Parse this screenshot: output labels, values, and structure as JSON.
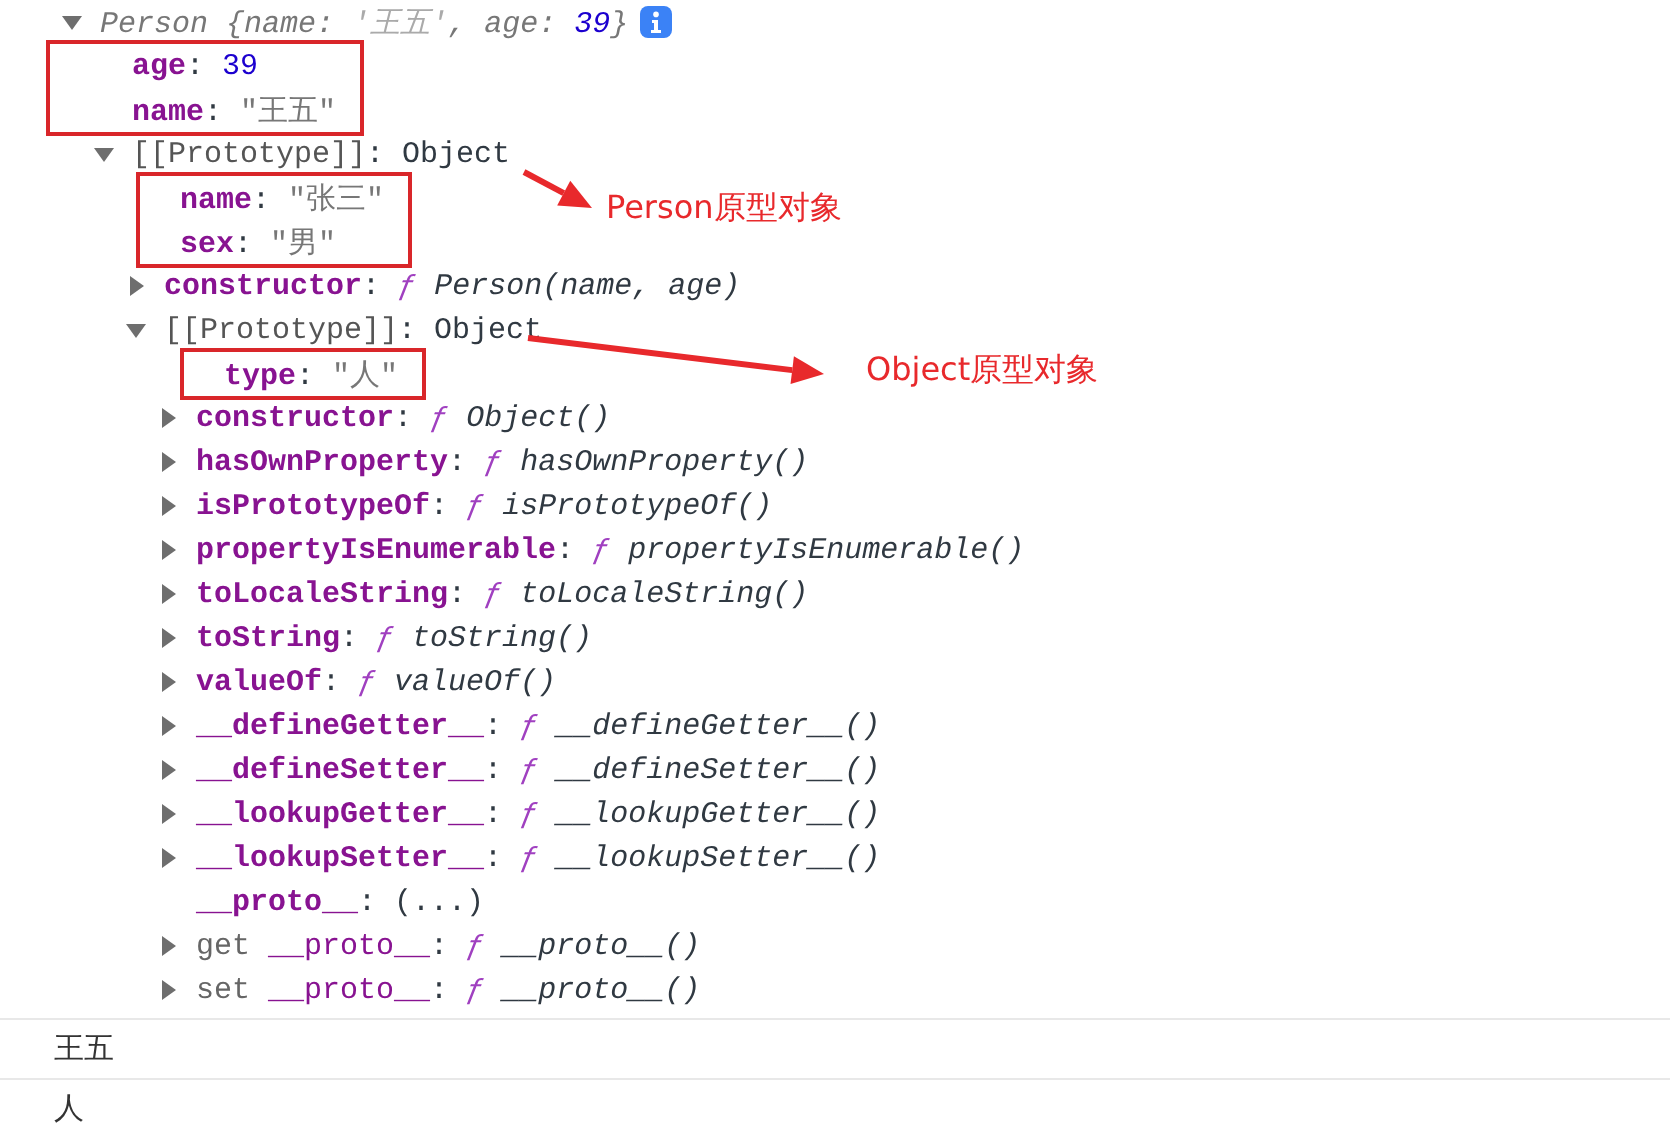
{
  "tree": [
    {
      "expanded": true,
      "info_badge": true,
      "parts": [
        {
          "text": "Person ",
          "kind": "summary"
        },
        {
          "text": "{",
          "kind": "summary"
        },
        {
          "text": "name",
          "kind": "skey"
        },
        {
          "text": ": ",
          "kind": "summary"
        },
        {
          "text": "'王五'",
          "kind": "sstring"
        },
        {
          "text": ", ",
          "kind": "summary"
        },
        {
          "text": "age",
          "kind": "skey"
        },
        {
          "text": ": ",
          "kind": "summary"
        },
        {
          "text": "39",
          "kind": "snumber"
        },
        {
          "text": "}",
          "kind": "summary"
        }
      ],
      "children": [
        {
          "boxed": true,
          "parts": [
            {
              "text": "age",
              "kind": "key"
            },
            {
              "text": ": ",
              "kind": "punct"
            },
            {
              "text": "39",
              "kind": "number"
            }
          ]
        },
        {
          "boxed": true,
          "parts": [
            {
              "text": "name",
              "kind": "key"
            },
            {
              "text": ": ",
              "kind": "punct"
            },
            {
              "text": "\"王五\"",
              "kind": "string"
            }
          ]
        },
        {
          "expanded": true,
          "parts": [
            {
              "text": "[[Prototype]]",
              "kind": "internal"
            },
            {
              "text": ": ",
              "kind": "punct"
            },
            {
              "text": "Object",
              "kind": "object"
            }
          ],
          "children": [
            {
              "boxed": true,
              "parts": [
                {
                  "text": "name",
                  "kind": "key"
                },
                {
                  "text": ": ",
                  "kind": "punct"
                },
                {
                  "text": "\"张三\"",
                  "kind": "string"
                }
              ]
            },
            {
              "boxed": true,
              "parts": [
                {
                  "text": "sex",
                  "kind": "key"
                },
                {
                  "text": ": ",
                  "kind": "punct"
                },
                {
                  "text": "\"男\"",
                  "kind": "string"
                }
              ]
            },
            {
              "expanded": false,
              "parts": [
                {
                  "text": "constructor",
                  "kind": "key"
                },
                {
                  "text": ": ",
                  "kind": "punct"
                },
                {
                  "text": "ƒ ",
                  "kind": "fsign"
                },
                {
                  "text": "Person(name, age)",
                  "kind": "fname"
                }
              ]
            },
            {
              "expanded": true,
              "parts": [
                {
                  "text": "[[Prototype]]",
                  "kind": "internal"
                },
                {
                  "text": ": ",
                  "kind": "punct"
                },
                {
                  "text": "Object",
                  "kind": "object"
                }
              ],
              "children": [
                {
                  "boxed": true,
                  "parts": [
                    {
                      "text": "type",
                      "kind": "key"
                    },
                    {
                      "text": ": ",
                      "kind": "punct"
                    },
                    {
                      "text": "\"人\"",
                      "kind": "string"
                    }
                  ]
                },
                {
                  "expanded": false,
                  "parts": [
                    {
                      "text": "constructor",
                      "kind": "key"
                    },
                    {
                      "text": ": ",
                      "kind": "punct"
                    },
                    {
                      "text": "ƒ ",
                      "kind": "fsign"
                    },
                    {
                      "text": "Object()",
                      "kind": "fname"
                    }
                  ]
                },
                {
                  "expanded": false,
                  "parts": [
                    {
                      "text": "hasOwnProperty",
                      "kind": "key"
                    },
                    {
                      "text": ": ",
                      "kind": "punct"
                    },
                    {
                      "text": "ƒ ",
                      "kind": "fsign"
                    },
                    {
                      "text": "hasOwnProperty()",
                      "kind": "fname"
                    }
                  ]
                },
                {
                  "expanded": false,
                  "parts": [
                    {
                      "text": "isPrototypeOf",
                      "kind": "key"
                    },
                    {
                      "text": ": ",
                      "kind": "punct"
                    },
                    {
                      "text": "ƒ ",
                      "kind": "fsign"
                    },
                    {
                      "text": "isPrototypeOf()",
                      "kind": "fname"
                    }
                  ]
                },
                {
                  "expanded": false,
                  "parts": [
                    {
                      "text": "propertyIsEnumerable",
                      "kind": "key"
                    },
                    {
                      "text": ": ",
                      "kind": "punct"
                    },
                    {
                      "text": "ƒ ",
                      "kind": "fsign"
                    },
                    {
                      "text": "propertyIsEnumerable()",
                      "kind": "fname"
                    }
                  ]
                },
                {
                  "expanded": false,
                  "parts": [
                    {
                      "text": "toLocaleString",
                      "kind": "key"
                    },
                    {
                      "text": ": ",
                      "kind": "punct"
                    },
                    {
                      "text": "ƒ ",
                      "kind": "fsign"
                    },
                    {
                      "text": "toLocaleString()",
                      "kind": "fname"
                    }
                  ]
                },
                {
                  "expanded": false,
                  "parts": [
                    {
                      "text": "toString",
                      "kind": "key"
                    },
                    {
                      "text": ": ",
                      "kind": "punct"
                    },
                    {
                      "text": "ƒ ",
                      "kind": "fsign"
                    },
                    {
                      "text": "toString()",
                      "kind": "fname"
                    }
                  ]
                },
                {
                  "expanded": false,
                  "parts": [
                    {
                      "text": "valueOf",
                      "kind": "key"
                    },
                    {
                      "text": ": ",
                      "kind": "punct"
                    },
                    {
                      "text": "ƒ ",
                      "kind": "fsign"
                    },
                    {
                      "text": "valueOf()",
                      "kind": "fname"
                    }
                  ]
                },
                {
                  "expanded": false,
                  "parts": [
                    {
                      "text": "__defineGetter__",
                      "kind": "key"
                    },
                    {
                      "text": ": ",
                      "kind": "punct"
                    },
                    {
                      "text": "ƒ ",
                      "kind": "fsign"
                    },
                    {
                      "text": "__defineGetter__()",
                      "kind": "fname"
                    }
                  ]
                },
                {
                  "expanded": false,
                  "parts": [
                    {
                      "text": "__defineSetter__",
                      "kind": "key"
                    },
                    {
                      "text": ": ",
                      "kind": "punct"
                    },
                    {
                      "text": "ƒ ",
                      "kind": "fsign"
                    },
                    {
                      "text": "__defineSetter__()",
                      "kind": "fname"
                    }
                  ]
                },
                {
                  "expanded": false,
                  "parts": [
                    {
                      "text": "__lookupGetter__",
                      "kind": "key"
                    },
                    {
                      "text": ": ",
                      "kind": "punct"
                    },
                    {
                      "text": "ƒ ",
                      "kind": "fsign"
                    },
                    {
                      "text": "__lookupGetter__()",
                      "kind": "fname"
                    }
                  ]
                },
                {
                  "expanded": false,
                  "parts": [
                    {
                      "text": "__lookupSetter__",
                      "kind": "key"
                    },
                    {
                      "text": ": ",
                      "kind": "punct"
                    },
                    {
                      "text": "ƒ ",
                      "kind": "fsign"
                    },
                    {
                      "text": "__lookupSetter__()",
                      "kind": "fname"
                    }
                  ]
                },
                {
                  "parts": [
                    {
                      "text": "__proto__",
                      "kind": "key"
                    },
                    {
                      "text": ": ",
                      "kind": "punct"
                    },
                    {
                      "text": "(...)",
                      "kind": "object"
                    }
                  ]
                },
                {
                  "expanded": false,
                  "parts": [
                    {
                      "text": "get ",
                      "kind": "accessor"
                    },
                    {
                      "text": "__proto__",
                      "kind": "akey"
                    },
                    {
                      "text": ": ",
                      "kind": "punct"
                    },
                    {
                      "text": "ƒ ",
                      "kind": "fsign"
                    },
                    {
                      "text": "__proto__()",
                      "kind": "fname"
                    }
                  ]
                },
                {
                  "expanded": false,
                  "parts": [
                    {
                      "text": "set ",
                      "kind": "accessor"
                    },
                    {
                      "text": "__proto__",
                      "kind": "akey"
                    },
                    {
                      "text": ": ",
                      "kind": "punct"
                    },
                    {
                      "text": "ƒ ",
                      "kind": "fsign"
                    },
                    {
                      "text": "__proto__()",
                      "kind": "fname"
                    }
                  ]
                }
              ]
            }
          ]
        }
      ]
    }
  ],
  "annotations": [
    {
      "label": "Person原型对象"
    },
    {
      "label": "Object原型对象"
    }
  ],
  "console_output": [
    "王五",
    "人"
  ]
}
